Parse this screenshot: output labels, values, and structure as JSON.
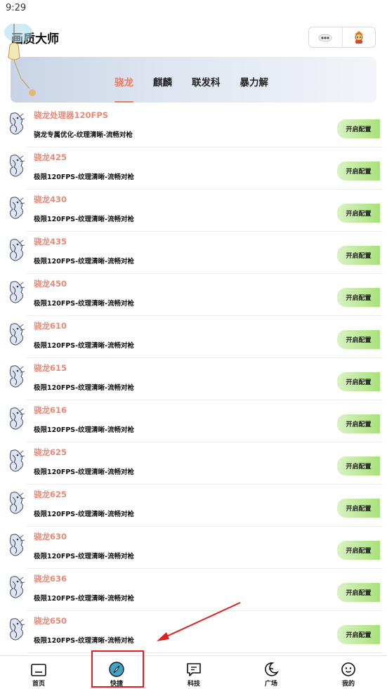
{
  "status_bar": {
    "time": "9:29"
  },
  "header": {
    "title": "画质大师"
  },
  "tabs": [
    {
      "label": "骁龙",
      "active": true
    },
    {
      "label": "麒麟",
      "active": false
    },
    {
      "label": "联发科",
      "active": false
    },
    {
      "label": "暴力解",
      "active": false
    }
  ],
  "items": [
    {
      "title": "骁龙处理器120FPS",
      "subtitle": "骁龙专属优化-纹理清晰-流畅对枪",
      "button": "开启配置"
    },
    {
      "title": "骁龙425",
      "subtitle": "极限120FPS-纹理清晰-流畅对枪",
      "button": "开启配置"
    },
    {
      "title": "骁龙430",
      "subtitle": "极限120FPS-纹理清晰-流畅对枪",
      "button": "开启配置"
    },
    {
      "title": "骁龙435",
      "subtitle": "极限120FPS-纹理清晰-流畅对枪",
      "button": "开启配置"
    },
    {
      "title": "骁龙450",
      "subtitle": "极限120FPS-纹理清晰-流畅对枪",
      "button": "开启配置"
    },
    {
      "title": "骁龙610",
      "subtitle": "极限120FPS-纹理清晰-流畅对枪",
      "button": "开启配置"
    },
    {
      "title": "骁龙615",
      "subtitle": "极限120FPS-纹理清晰-流畅对枪",
      "button": "开启配置"
    },
    {
      "title": "骁龙616",
      "subtitle": "极限120FPS-纹理清晰-流畅对枪",
      "button": "开启配置"
    },
    {
      "title": "骁龙625",
      "subtitle": "极限120FPS-纹理清晰-流畅对枪",
      "button": "开启配置"
    },
    {
      "title": "骁龙625",
      "subtitle": "极限120FPS-纹理清晰-流畅对枪",
      "button": "开启配置"
    },
    {
      "title": "骁龙630",
      "subtitle": "极限120FPS-纹理清晰-流畅对枪",
      "button": "开启配置"
    },
    {
      "title": "骁龙636",
      "subtitle": "极限120FPS-纹理清晰-流畅对枪",
      "button": "开启配置"
    },
    {
      "title": "骁龙650",
      "subtitle": "极限120FPS-纹理清晰-流畅对枪",
      "button": "开启配置"
    }
  ],
  "bottom_nav": [
    {
      "label": "首页",
      "icon": "home-icon"
    },
    {
      "label": "快捷",
      "icon": "compass-icon"
    },
    {
      "label": "科技",
      "icon": "message-icon"
    },
    {
      "label": "广场",
      "icon": "moon-icon"
    },
    {
      "label": "我的",
      "icon": "profile-icon"
    }
  ],
  "colors": {
    "accent": "#f07a5c",
    "item_title": "#e98a78",
    "config_button_start": "#d9f3c4",
    "config_button_end": "#a8e07a",
    "compass": "#3aa6c9",
    "annotation": "#e02020"
  }
}
